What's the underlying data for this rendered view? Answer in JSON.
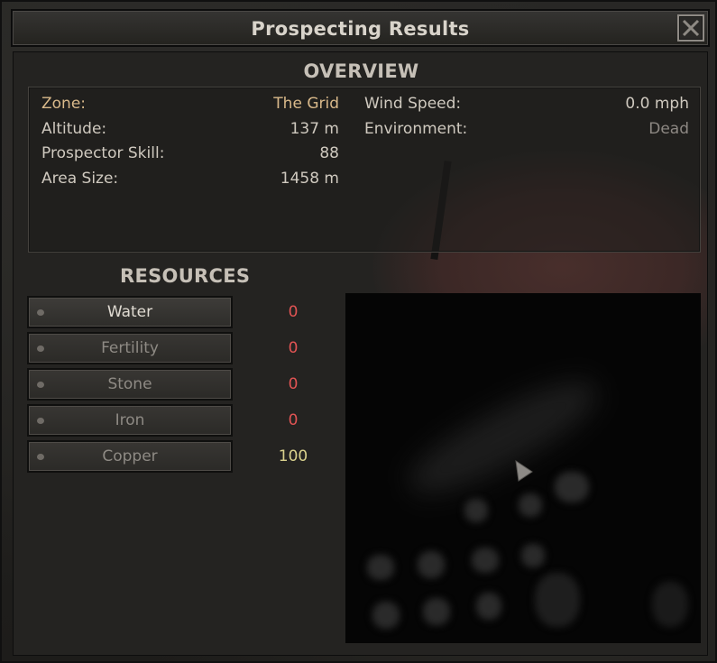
{
  "window": {
    "title": "Prospecting Results"
  },
  "overview": {
    "title": "OVERVIEW",
    "left": [
      {
        "label": "Zone:",
        "value": "The Grid"
      },
      {
        "label": "Altitude:",
        "value": "137 m"
      },
      {
        "label": "Prospector Skill:",
        "value": "88"
      },
      {
        "label": "Area Size:",
        "value": "1458 m"
      }
    ],
    "right": [
      {
        "label": "Wind Speed:",
        "value": "0.0 mph"
      },
      {
        "label": "Environment:",
        "value": "Dead"
      }
    ]
  },
  "resources": {
    "title": "RESOURCES",
    "items": [
      {
        "label": "Water",
        "value": "0",
        "selected": true
      },
      {
        "label": "Fertility",
        "value": "0",
        "selected": false
      },
      {
        "label": "Stone",
        "value": "0",
        "selected": false
      },
      {
        "label": "Iron",
        "value": "0",
        "selected": false
      },
      {
        "label": "Copper",
        "value": "100",
        "selected": false
      }
    ]
  },
  "colors": {
    "zero_value": "#e25454",
    "positive_value": "#d8d08c",
    "zone_highlight": "#d9b98a"
  },
  "icons": {
    "close": "close-x-icon",
    "player_marker": "player-arrow-icon"
  }
}
